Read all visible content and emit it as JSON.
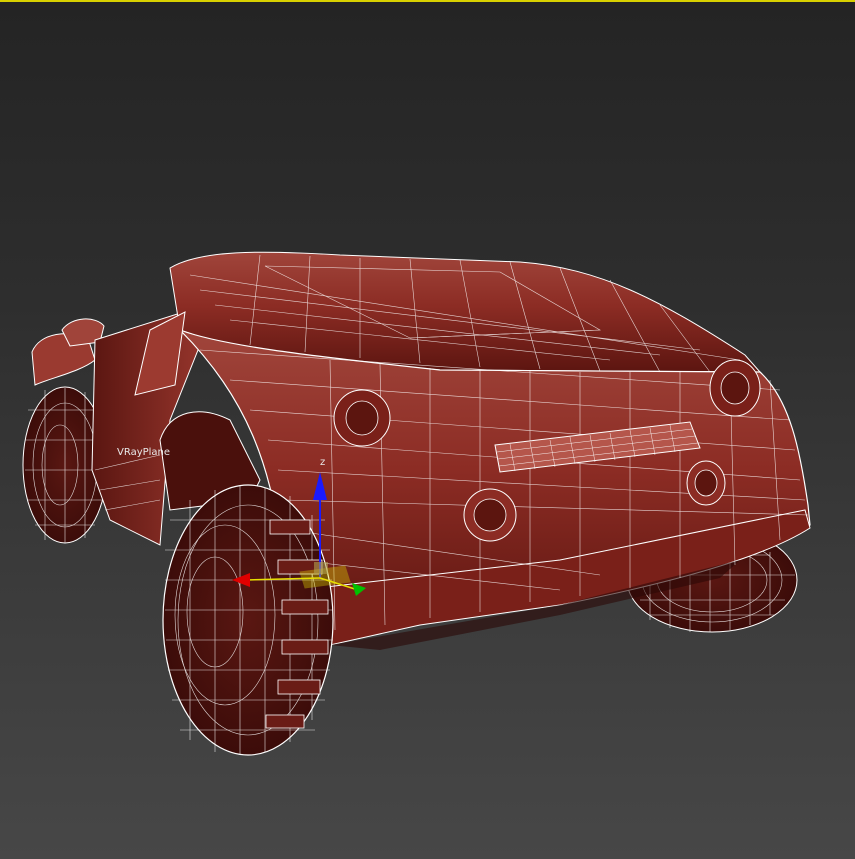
{
  "viewport": {
    "active_border_color": "#d8d000",
    "object_label": "VRayPlane",
    "gizmo": {
      "z_label": "z",
      "colors": {
        "x": "#e00000",
        "y": "#00c000",
        "z": "#1a1aff",
        "plane": "#e8e000"
      }
    },
    "model": {
      "body_color": "#8a2a22",
      "wire_color": "#ffffff"
    }
  }
}
